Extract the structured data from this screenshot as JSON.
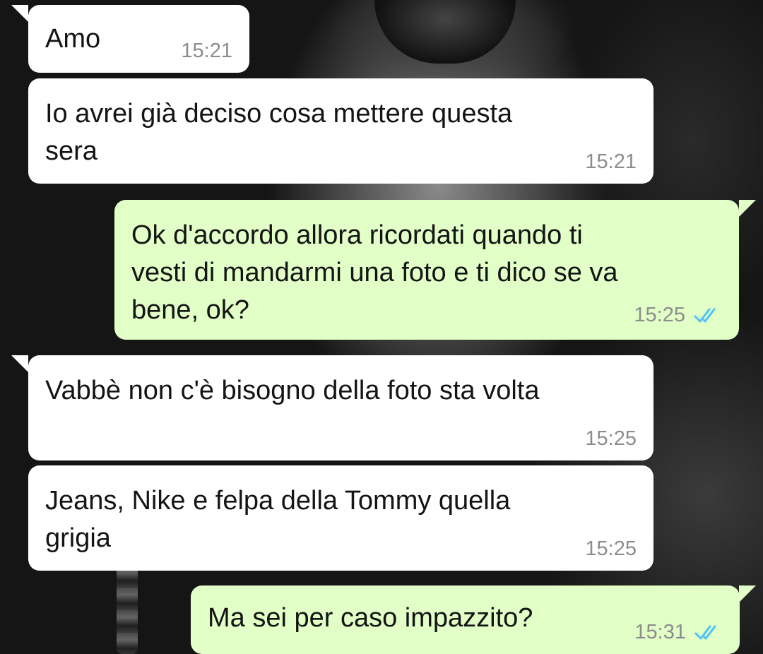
{
  "chat": {
    "messages": [
      {
        "direction": "incoming",
        "text": "Amo",
        "time": "15:21"
      },
      {
        "direction": "incoming",
        "text": "Io avrei già deciso cosa mettere questa\nsera",
        "time": "15:21"
      },
      {
        "direction": "outgoing",
        "text": "Ok d'accordo allora ricordati quando ti\nvesti di mandarmi una foto e ti dico se va\nbene, ok?",
        "time": "15:25",
        "status": "read-double-check-icon"
      },
      {
        "direction": "incoming",
        "text": "Vabbè non c'è bisogno della foto sta volta",
        "time": "15:25"
      },
      {
        "direction": "incoming",
        "text": "Jeans, Nike e felpa della Tommy quella\ngrigia",
        "time": "15:25"
      },
      {
        "direction": "outgoing",
        "text": "Ma sei per caso impazzito?",
        "time": "15:31",
        "status": "read-double-check-icon"
      }
    ]
  },
  "colors": {
    "incoming_bubble": "#ffffff",
    "outgoing_bubble": "#e1ffc7",
    "read_tick": "#4fc3f7",
    "timestamp": "#8c8c8c"
  }
}
